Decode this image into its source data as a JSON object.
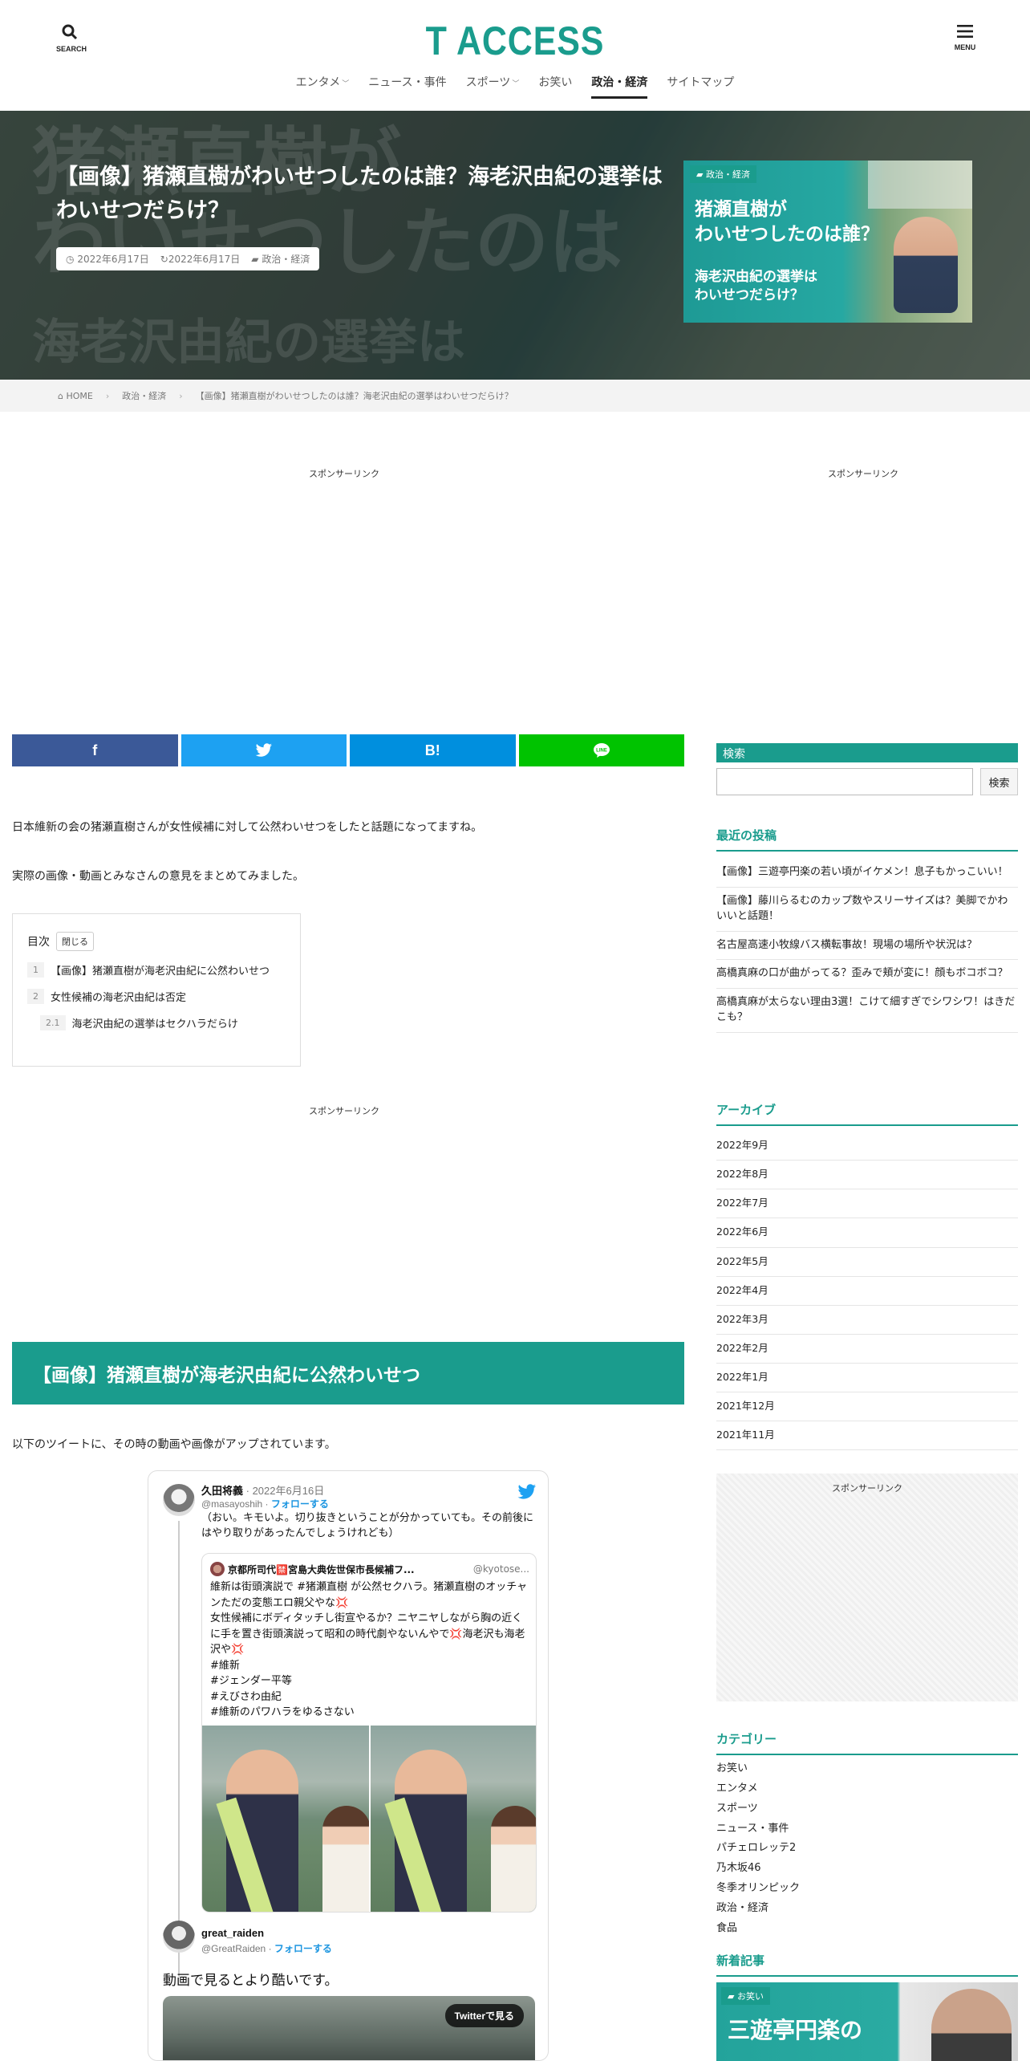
{
  "header": {
    "search_label": "SEARCH",
    "menu_label": "MENU",
    "logo": "T ACCESS",
    "nav": [
      {
        "label": "エンタメ",
        "caret": true
      },
      {
        "label": "ニュース・事件",
        "caret": false
      },
      {
        "label": "スポーツ",
        "caret": true
      },
      {
        "label": "お笑い",
        "caret": false
      },
      {
        "label": "政治・経済",
        "caret": false,
        "active": true
      },
      {
        "label": "サイトマップ",
        "caret": false
      }
    ]
  },
  "hero": {
    "bg_text_1": "猪瀬直樹が",
    "bg_text_2": "わいせつしたのは",
    "bg_text_3": "海老沢由紀の選挙は",
    "title": "【画像】猪瀬直樹がわいせつしたのは誰？海老沢由紀の選挙はわいせつだらけ？",
    "published": "2022年6月17日",
    "updated": "2022年6月17日",
    "category": "政治・経済",
    "thumb": {
      "category": "政治・経済",
      "line1": "猪瀬直樹が",
      "line2": "わいせつしたのは誰？",
      "line3": "海老沢由紀の選挙は",
      "line4": "わいせつだらけ？"
    }
  },
  "breadcrumb": [
    "HOME",
    "政治・経済",
    "【画像】猪瀬直樹がわいせつしたのは誰？海老沢由紀の選挙はわいせつだらけ？"
  ],
  "sponsor_label": "スポンサーリンク",
  "share": {
    "facebook": "f",
    "twitter": "t",
    "hatena": "B!",
    "line": "LINE"
  },
  "article": {
    "intro1": "日本維新の会の猪瀬直樹さんが女性候補に対して公然わいせつをしたと話題になってますね。",
    "intro2": "実際の画像・動画とみなさんの意見をまとめてみました。",
    "toc": {
      "title": "目次",
      "close": "閉じる",
      "items": [
        {
          "num": "1",
          "label": "【画像】猪瀬直樹が海老沢由紀に公然わいせつ"
        },
        {
          "num": "2",
          "label": "女性候補の海老沢由紀は否定"
        },
        {
          "num": "2.1",
          "label": "海老沢由紀の選挙はセクハラだらけ"
        }
      ]
    },
    "h2": "【画像】猪瀬直樹が海老沢由紀に公然わいせつ",
    "after_h2": "以下のツイートに、その時の動画や画像がアップされています。"
  },
  "tweet": {
    "name": "久田将義",
    "date": "· 2022年6月16日",
    "handle": "@masayoshih",
    "follow": "フォローする",
    "text": "（おい。キモいよ。切り抜きということが分かっていても。その前後にはやり取りがあったんでしょうけれども）",
    "quote": {
      "name": "京都所司代🈲宮島大典佐世保市長候補フ...",
      "handle": "@kyotose...",
      "body": [
        "維新は街頭演説で #猪瀬直樹 が公然セクハラ。猪瀬直樹のオッチャンただの変態エロ親父やな💢",
        "女性候補にボディタッチし街宣やるか？ニヤニヤしながら胸の近くに手を置き街頭演説って昭和の時代劇やないんやで💢海老沢も海老沢や💢",
        "#維新",
        "#ジェンダー平等",
        "#えびさわ由紀",
        "#維新のパワハラをゆるさない"
      ]
    },
    "reply": {
      "name": "great_raiden",
      "handle": "@GreatRaiden",
      "follow": "フォローする",
      "text": "動画で見るとより酷いです。",
      "video_button": "Twitterで見る"
    }
  },
  "sidebar": {
    "search_label": "検索",
    "search_button": "検索",
    "recent_title": "最近の投稿",
    "recent": [
      "【画像】三遊亭円楽の若い頃がイケメン！息子もかっこいい！",
      "【画像】藤川らるむのカップ数やスリーサイズは？美脚でかわいいと話題！",
      "名古屋高速小牧線バス横転事故！現場の場所や状況は？",
      "高橋真麻の口が曲がってる？歪みで頬が変に！顔もボコボコ？",
      "高橋真麻が太らない理由3選！こけて細すぎでシワシワ！はきだこも？"
    ],
    "archive_title": "アーカイブ",
    "archives": [
      "2022年9月",
      "2022年8月",
      "2022年7月",
      "2022年6月",
      "2022年5月",
      "2022年4月",
      "2022年3月",
      "2022年2月",
      "2022年1月",
      "2021年12月",
      "2021年11月"
    ],
    "category_title": "カテゴリー",
    "categories": [
      "お笑い",
      "エンタメ",
      "スポーツ",
      "ニュース・事件",
      "パチェロレッテ2",
      "乃木坂46",
      "冬季オリンピック",
      "政治・経済",
      "食品"
    ],
    "new_title": "新着記事",
    "new_thumb": {
      "category": "お笑い",
      "text": "三遊亭円楽の"
    }
  },
  "colors": {
    "accent": "#1a9c8d",
    "facebook": "#3b5998",
    "twitter": "#1da1f2",
    "hatena": "#008fde",
    "line": "#00c300"
  }
}
